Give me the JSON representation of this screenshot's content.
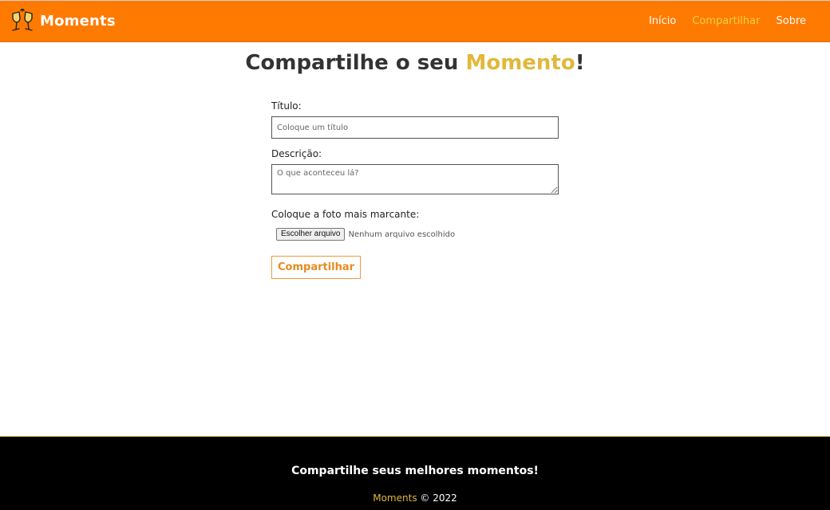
{
  "header": {
    "brand": "Moments",
    "logo_icon": "champagne-glasses-icon",
    "nav": [
      {
        "label": "Início",
        "active": false
      },
      {
        "label": "Compartilhar",
        "active": true
      },
      {
        "label": "Sobre",
        "active": false
      }
    ]
  },
  "main": {
    "title_prefix": "Compartilhe o seu ",
    "title_accent": "Momento",
    "title_suffix": "!",
    "form": {
      "title_label": "Título:",
      "title_placeholder": "Coloque um título",
      "description_label": "Descrição:",
      "description_placeholder": "O que aconteceu lá?",
      "photo_label": "Coloque a foto mais marcante:",
      "file_button": "Escolher arquivo",
      "file_status": "Nenhum arquivo escolhido",
      "submit_label": "Compartilhar"
    }
  },
  "footer": {
    "tagline": "Compartilhe seus melhores momentos!",
    "brand": "Moments",
    "copyright": " © 2022"
  },
  "colors": {
    "header_bg": "#ff7a00",
    "accent": "#e1b83b",
    "button_border": "#f2993b",
    "footer_bg": "#000000"
  }
}
